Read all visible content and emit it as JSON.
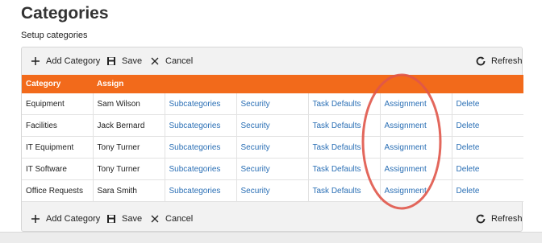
{
  "page": {
    "title": "Categories",
    "subtitle": "Setup categories"
  },
  "toolbar": {
    "add_label": "Add Category",
    "save_label": "Save",
    "cancel_label": "Cancel",
    "refresh_label": "Refresh"
  },
  "table": {
    "headers": [
      "Category",
      "Assign",
      "",
      "",
      "",
      "",
      ""
    ],
    "rows": [
      {
        "category": "Equipment",
        "assign": "Sam Wilson",
        "subcategories": "Subcategories",
        "security": "Security",
        "task_defaults": "Task Defaults",
        "assignment": "Assignment",
        "delete": "Delete"
      },
      {
        "category": "Facilities",
        "assign": "Jack Bernard",
        "subcategories": "Subcategories",
        "security": "Security",
        "task_defaults": "Task Defaults",
        "assignment": "Assignment",
        "delete": "Delete"
      },
      {
        "category": "IT Equipment",
        "assign": "Tony Turner",
        "subcategories": "Subcategories",
        "security": "Security",
        "task_defaults": "Task Defaults",
        "assignment": "Assignment",
        "delete": "Delete"
      },
      {
        "category": "IT Software",
        "assign": "Tony Turner",
        "subcategories": "Subcategories",
        "security": "Security",
        "task_defaults": "Task Defaults",
        "assignment": "Assignment",
        "delete": "Delete"
      },
      {
        "category": "Office Requests",
        "assign": "Sara Smith",
        "subcategories": "Subcategories",
        "security": "Security",
        "task_defaults": "Task Defaults",
        "assignment": "Assignment",
        "delete": "Delete"
      }
    ]
  },
  "colors": {
    "header_bg": "#f26a1b",
    "link": "#2a6fb5",
    "highlight": "#e0574a"
  },
  "icons": {
    "add": "plus-icon",
    "save": "floppy-disk-icon",
    "cancel": "close-icon",
    "refresh": "refresh-icon"
  }
}
